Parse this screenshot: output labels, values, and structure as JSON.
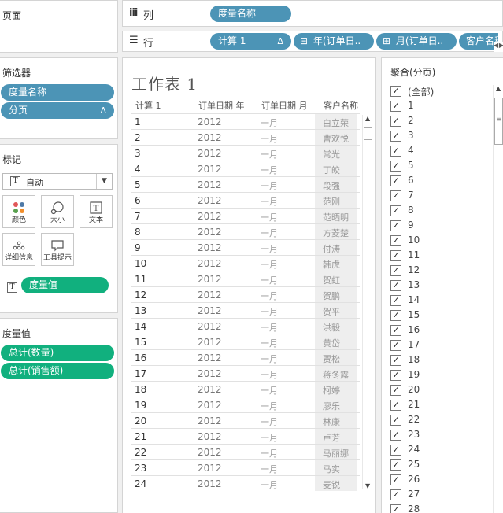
{
  "left": {
    "pages_title": "页面",
    "filters_title": "筛选器",
    "filters": [
      {
        "label": "度量名称",
        "has_delta": false
      },
      {
        "label": "分页",
        "has_delta": true
      }
    ],
    "marks_title": "标记",
    "mark_type": "自动",
    "mark_buttons": [
      {
        "label": "颜色",
        "icon": "color-dots-icon"
      },
      {
        "label": "大小",
        "icon": "size-icon"
      },
      {
        "label": "文本",
        "icon": "text-icon"
      },
      {
        "label": "详细信息",
        "icon": "detail-icon"
      },
      {
        "label": "工具提示",
        "icon": "tooltip-icon"
      }
    ],
    "mark_pill": "度量值",
    "measure_values_title": "度量值",
    "measure_values": [
      "总计(数量)",
      "总计(销售额)"
    ]
  },
  "shelves": {
    "columns_label": "列",
    "columns_pills": [
      "度量名称"
    ],
    "rows_label": "行",
    "rows_pills": [
      {
        "label": "计算 1",
        "prefix": "",
        "suffix": "Δ"
      },
      {
        "label": "年(订单日..",
        "prefix": "⊟",
        "suffix": ""
      },
      {
        "label": "月(订单日..",
        "prefix": "⊞",
        "suffix": ""
      },
      {
        "label": "客户名称",
        "prefix": "",
        "suffix": ""
      }
    ]
  },
  "sheet": {
    "title": "工作表 1",
    "headers": [
      "计算 1",
      "订单日期 年",
      "订单日期 月",
      "客户名称"
    ],
    "rows": [
      [
        "1",
        "2012",
        "一月",
        "白立荣"
      ],
      [
        "2",
        "2012",
        "一月",
        "曹欢悦"
      ],
      [
        "3",
        "2012",
        "一月",
        "常光"
      ],
      [
        "4",
        "2012",
        "一月",
        "丁皎"
      ],
      [
        "5",
        "2012",
        "一月",
        "段强"
      ],
      [
        "6",
        "2012",
        "一月",
        "范刚"
      ],
      [
        "7",
        "2012",
        "一月",
        "范晒明"
      ],
      [
        "8",
        "2012",
        "一月",
        "方菱楚"
      ],
      [
        "9",
        "2012",
        "一月",
        "付涛"
      ],
      [
        "10",
        "2012",
        "一月",
        "韩虎"
      ],
      [
        "11",
        "2012",
        "一月",
        "贺虹"
      ],
      [
        "12",
        "2012",
        "一月",
        "贺鹏"
      ],
      [
        "13",
        "2012",
        "一月",
        "贺平"
      ],
      [
        "14",
        "2012",
        "一月",
        "洪毅"
      ],
      [
        "15",
        "2012",
        "一月",
        "黄岱"
      ],
      [
        "16",
        "2012",
        "一月",
        "贾松"
      ],
      [
        "17",
        "2012",
        "一月",
        "蒋冬露"
      ],
      [
        "18",
        "2012",
        "一月",
        "柯婷"
      ],
      [
        "19",
        "2012",
        "一月",
        "廖乐"
      ],
      [
        "20",
        "2012",
        "一月",
        "林康"
      ],
      [
        "21",
        "2012",
        "一月",
        "卢芳"
      ],
      [
        "22",
        "2012",
        "一月",
        "马丽娜"
      ],
      [
        "23",
        "2012",
        "一月",
        "马实"
      ],
      [
        "24",
        "2012",
        "一月",
        "麦锐"
      ]
    ]
  },
  "filter_card": {
    "title": "聚合(分页)",
    "items": [
      "(全部)",
      "1",
      "2",
      "3",
      "4",
      "5",
      "6",
      "7",
      "8",
      "9",
      "10",
      "11",
      "12",
      "13",
      "14",
      "15",
      "16",
      "17",
      "18",
      "19",
      "20",
      "21",
      "22",
      "23",
      "24",
      "25",
      "26",
      "27",
      "28"
    ]
  },
  "colors": {
    "blue_pill": "#4c94b6",
    "green_pill": "#11b07e"
  }
}
